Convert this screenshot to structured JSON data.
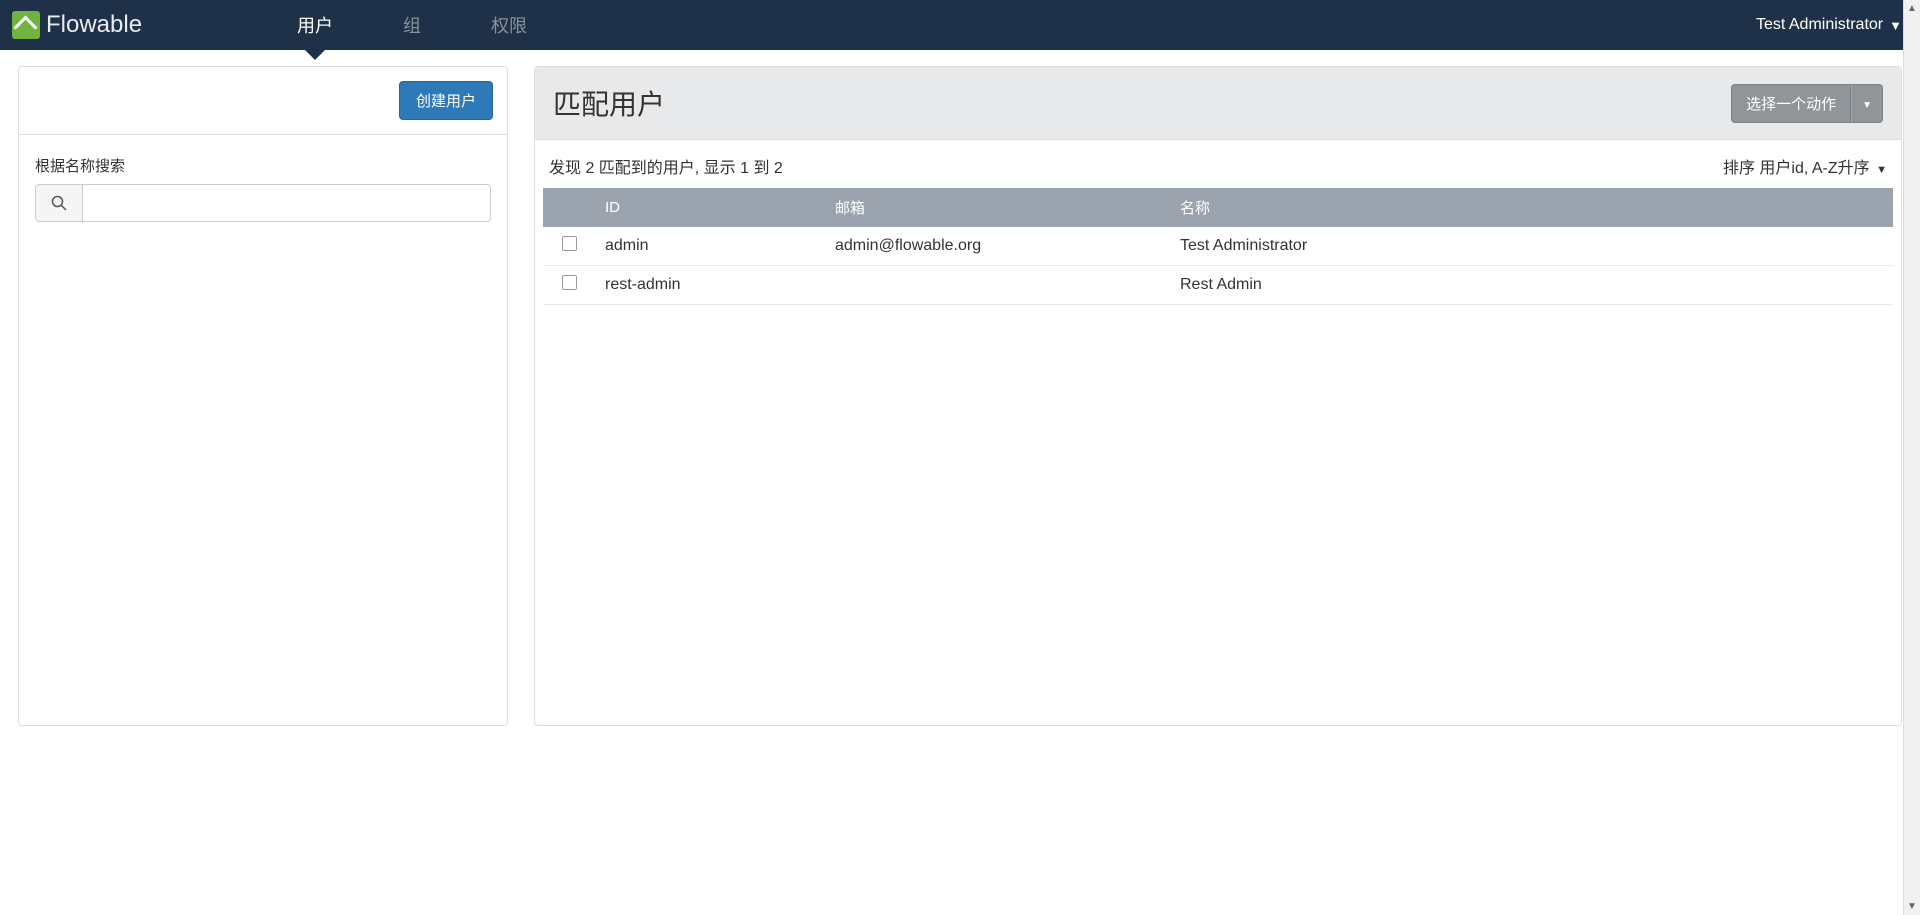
{
  "header": {
    "logo_text": "Flowable",
    "nav": [
      {
        "label": "用户",
        "active": true
      },
      {
        "label": "组",
        "active": false
      },
      {
        "label": "权限",
        "active": false
      }
    ],
    "user_label": "Test Administrator"
  },
  "sidebar": {
    "create_btn": "创建用户",
    "search_label": "根据名称搜索",
    "search_value": ""
  },
  "main": {
    "title": "匹配用户",
    "action_btn": "选择一个动作",
    "result_text": "发现 2 匹配到的用户, 显示 1 到 2",
    "sort_text": "排序 用户id, A-Z升序",
    "columns": {
      "id": "ID",
      "email": "邮箱",
      "name": "名称"
    },
    "rows": [
      {
        "id": "admin",
        "email": "admin@flowable.org",
        "name": "Test Administrator"
      },
      {
        "id": "rest-admin",
        "email": "",
        "name": "Rest Admin"
      }
    ]
  }
}
